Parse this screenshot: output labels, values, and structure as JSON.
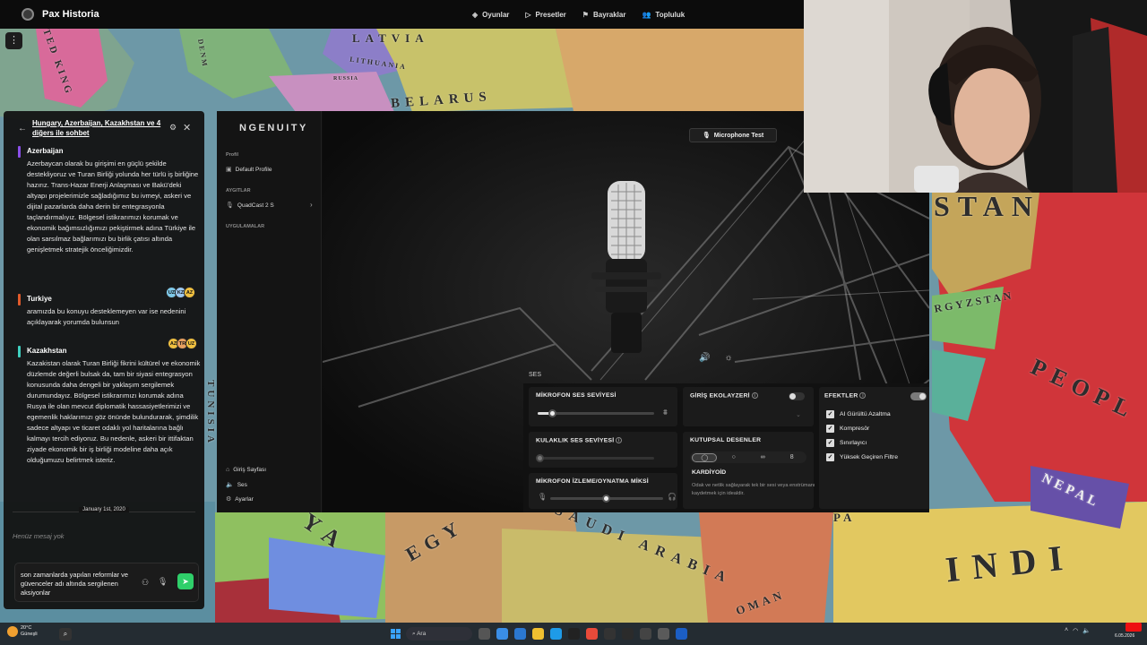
{
  "app": {
    "name": "Pax Historia"
  },
  "nav": {
    "items": [
      {
        "label": "Oyunlar",
        "icon": "gamepad-icon"
      },
      {
        "label": "Presetler",
        "icon": "play-icon"
      },
      {
        "label": "Bayraklar",
        "icon": "flag-icon"
      },
      {
        "label": "Topluluk",
        "icon": "users-icon"
      }
    ]
  },
  "map": {
    "labels": [
      "LATVIA",
      "LITHUANIA",
      "RUSSIA",
      "BELARUS",
      "STAN",
      "RGYZSTAN",
      "PEOPL",
      "NEPAL",
      "INDI",
      "SAUDI ARABIA",
      "EGY",
      "YA",
      "OMAN",
      "PA",
      "TUNISIA",
      "ITED KING",
      "DENM"
    ]
  },
  "chat": {
    "title": "Hungary, Azerbaijan, Kazakhstan ve 4 diğers ile sohbet",
    "messages": [
      {
        "name": "Azerbaijan",
        "color": "#8a4fe8",
        "text": "Azerbaycan olarak bu girişimi en güçlü şekilde destekliyoruz ve Turan Birliği yolunda her türlü iş birliğine hazırız. Trans-Hazar Enerji Anlaşması ve Bakü'deki altyapı projelerimizle sağladığımız bu ivmeyi, askeri ve dijital pazarlarda daha derin bir entegrasyonla taçlandırmalıyız. Bölgesel istikrarımızı korumak ve ekonomik bağımsızlığımızı pekiştirmek adına Türkiye ile olan sarsılmaz bağlarımızı bu birlik çatısı altında genişletmek stratejik önceliğimizdir."
      },
      {
        "name": "Turkiye",
        "color": "#e05a2b",
        "text": "aramızda bu konuyu desteklemeyen var ise nedenini açıklayarak yorumda bulunsun",
        "reactions": [
          "UZ",
          "KZ",
          "AZ"
        ]
      },
      {
        "name": "Kazakhstan",
        "color": "#3fd0c0",
        "text": "Kazakistan olarak Turan Birliği fikrini kültürel ve ekonomik düzlemde değerli bulsak da, tam bir siyasi entegrasyon konusunda daha dengeli bir yaklaşım sergilemek durumundayız. Bölgesel istikrarımızı korumak adına Rusya ile olan mevcut diplomatik hassasiyetlerimizi ve egemenlik haklarımızı göz önünde bulundurarak, şimdilik sadece altyapı ve ticaret odaklı yol haritalarına bağlı kalmayı tercih ediyoruz. Bu nedenle, askeri bir ittifaktan ziyade ekonomik bir iş birliği modeline daha açık olduğumuzu belirtmek isteriz.",
        "reactions": [
          "AZ",
          "TR",
          "UZ"
        ]
      }
    ],
    "date_divider": "January 1st, 2020",
    "placeholder": "Henüz mesaj yok",
    "input_value": "son zamanlarda yapılan reformlar ve güvenceler adı altında sergilenen aksiyonlar"
  },
  "ngenuity": {
    "logo": "NGENUITY",
    "sidebar": {
      "profile_section": "Profil",
      "profile_item": "Default Profile",
      "devices_section": "AYGITLAR",
      "device_item": "QuadCast 2 S",
      "apps_section": "UYGULAMALAR",
      "bottom": [
        "Giriş Sayfası",
        "Ses",
        "Ayarlar"
      ]
    },
    "mic_test": "Microphone Test",
    "ses_label": "SES",
    "mic_volume": {
      "title": "MİKROFON SES SEVİYESİ",
      "value": 0.15
    },
    "headphone_volume": {
      "title": "KULAKLIK SES SEVİYESİ",
      "value": 0.0
    },
    "monitor_mix": {
      "title": "MİKROFON İZLEME/OYNATMA MİKSİ",
      "value": 0.5
    },
    "input_eq": {
      "title": "GİRİŞ EKOLAYZERİ",
      "enabled": false
    },
    "polar": {
      "title": "KUTUPSAL DESENLER",
      "selected": "KARDİYOİD",
      "description": "Odak ve netlik sağlayarak tek bir sesi veya enstrümanı kaydetmek için idealdir."
    },
    "effects": {
      "title": "EFEKTLER",
      "enabled": true,
      "items": [
        "AI Gürültü Azaltma",
        "Kompresör",
        "Sınırlayıcı",
        "Yüksek Geçiren Filtre"
      ]
    }
  },
  "taskbar": {
    "weather_temp": "20°C",
    "weather_desc": "Güneşli",
    "search_placeholder": "Ara",
    "date": "6.05.2026"
  }
}
